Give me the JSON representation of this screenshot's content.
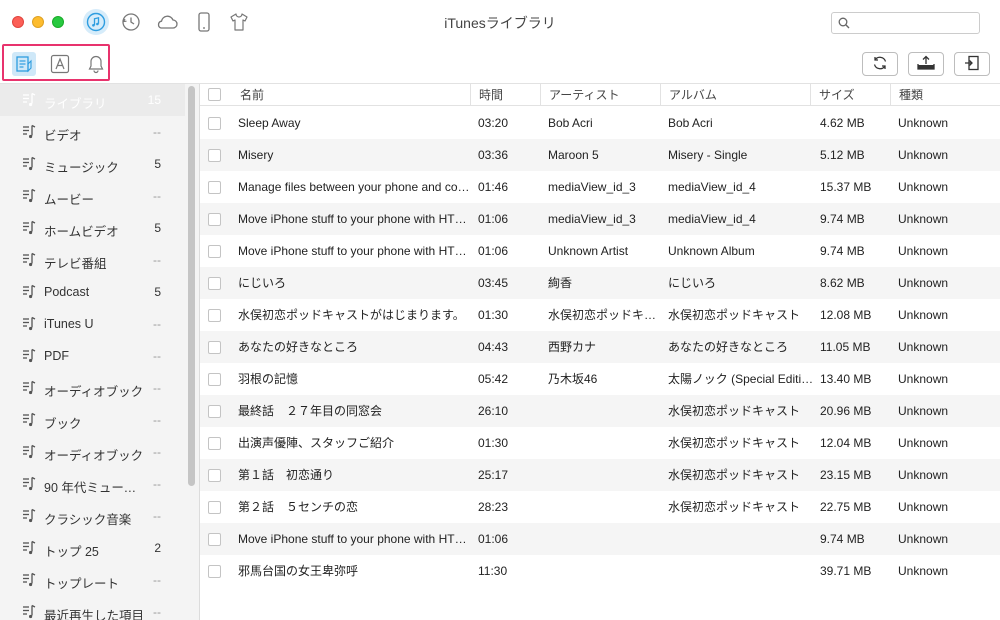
{
  "window": {
    "title": "iTunesライブラリ"
  },
  "search": {
    "placeholder": "",
    "value": ""
  },
  "top_icons": [
    "music-note-icon",
    "restore-icon",
    "cloud-icon",
    "phone-icon",
    "shirt-icon"
  ],
  "sub_icons": [
    "library-list-icon",
    "app-store-icon",
    "bell-icon"
  ],
  "toolbar_buttons": [
    "refresh-icon",
    "export-icon",
    "import-icon"
  ],
  "colors": {
    "highlight": "#e8336d",
    "accent": "#2e9de0"
  },
  "sidebar": {
    "items": [
      {
        "label": "ライブラリ",
        "count": "15",
        "selected": true
      },
      {
        "label": "ビデオ",
        "count": "--"
      },
      {
        "label": "ミュージック",
        "count": "5"
      },
      {
        "label": "ムービー",
        "count": "--"
      },
      {
        "label": "ホームビデオ",
        "count": "5"
      },
      {
        "label": "テレビ番組",
        "count": "--"
      },
      {
        "label": "Podcast",
        "count": "5"
      },
      {
        "label": "iTunes U",
        "count": "--"
      },
      {
        "label": "PDF",
        "count": "--"
      },
      {
        "label": "オーディオブック",
        "count": "--"
      },
      {
        "label": "ブック",
        "count": "--"
      },
      {
        "label": "オーディオブック",
        "count": "--"
      },
      {
        "label": "90 年代ミュージ…",
        "count": "--"
      },
      {
        "label": "クラシック音楽",
        "count": "--"
      },
      {
        "label": "トップ 25",
        "count": "2"
      },
      {
        "label": "トップレート",
        "count": "--"
      },
      {
        "label": "最近再生した項目",
        "count": "--"
      }
    ]
  },
  "table": {
    "columns": [
      "名前",
      "時間",
      "アーティスト",
      "アルバム",
      "サイズ",
      "種類"
    ],
    "rows": [
      [
        "Sleep Away",
        "03:20",
        "Bob Acri",
        "Bob Acri",
        "4.62 MB",
        "Unknown"
      ],
      [
        "Misery",
        "03:36",
        "Maroon 5",
        "Misery - Single",
        "5.12 MB",
        "Unknown"
      ],
      [
        "Manage files between your phone and co…",
        "01:46",
        "mediaView_id_3",
        "mediaView_id_4",
        "15.37 MB",
        "Unknown"
      ],
      [
        "Move iPhone stuff to your phone with HT…",
        "01:06",
        "mediaView_id_3",
        "mediaView_id_4",
        "9.74 MB",
        "Unknown"
      ],
      [
        "Move iPhone stuff to your phone with HT…",
        "01:06",
        "Unknown Artist",
        "Unknown Album",
        "9.74 MB",
        "Unknown"
      ],
      [
        "にじいろ",
        "03:45",
        "絢香",
        "にじいろ",
        "8.62 MB",
        "Unknown"
      ],
      [
        "水俣初恋ポッドキャストがはじまります。",
        "01:30",
        "水俣初恋ポッドキ…",
        "水俣初恋ポッドキャスト",
        "12.08 MB",
        "Unknown"
      ],
      [
        "あなたの好きなところ",
        "04:43",
        "西野カナ",
        "あなたの好きなところ",
        "11.05 MB",
        "Unknown"
      ],
      [
        "羽根の記憶",
        "05:42",
        "乃木坂46",
        "太陽ノック (Special Edition)",
        "13.40 MB",
        "Unknown"
      ],
      [
        "最終話　２７年目の同窓会",
        "26:10",
        "",
        "水俣初恋ポッドキャスト",
        "20.96 MB",
        "Unknown"
      ],
      [
        "出演声優陣、スタッフご紹介",
        "01:30",
        "",
        "水俣初恋ポッドキャスト",
        "12.04 MB",
        "Unknown"
      ],
      [
        "第１話　初恋通り",
        "25:17",
        "",
        "水俣初恋ポッドキャスト",
        "23.15 MB",
        "Unknown"
      ],
      [
        "第２話　５センチの恋",
        "28:23",
        "",
        "水俣初恋ポッドキャスト",
        "22.75 MB",
        "Unknown"
      ],
      [
        "Move iPhone stuff to your phone with HT…",
        "01:06",
        "",
        "",
        "9.74 MB",
        "Unknown"
      ],
      [
        "邪馬台国の女王卑弥呼",
        "11:30",
        "",
        "",
        "39.71 MB",
        "Unknown"
      ]
    ]
  }
}
